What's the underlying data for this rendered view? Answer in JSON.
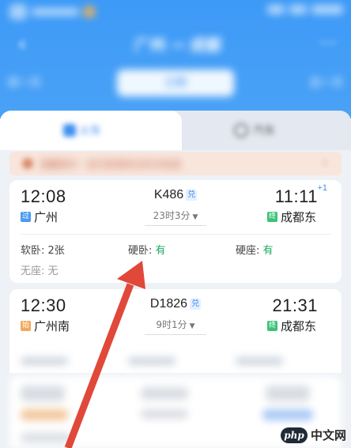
{
  "header": {
    "route_title": "广州 ⇀ 成都",
    "date_prev": "前一天",
    "date_next": "后一天",
    "date_selected": "日期"
  },
  "tabs": {
    "train": "火车",
    "other": "汽车"
  },
  "notice": "温馨提示 · 出行前请关注车次信息",
  "trains": [
    {
      "dep_time": "12:08",
      "arr_time": "11:11",
      "plus_day": "+1",
      "dep_tag": "过",
      "dep_station": "广州",
      "arr_tag": "终",
      "arr_station": "成都东",
      "train_no": "K486",
      "exchange": "兑",
      "duration": "23时3分",
      "seats": [
        {
          "label": "软卧: ",
          "value": "2张",
          "available": false
        },
        {
          "label": "硬卧: ",
          "value": "有",
          "available": true
        },
        {
          "label": "硬座: ",
          "value": "有",
          "available": true
        },
        {
          "label": "无座: ",
          "value": "无",
          "available": false
        }
      ]
    },
    {
      "dep_time": "12:30",
      "arr_time": "21:31",
      "dep_tag": "始",
      "dep_station": "广州南",
      "arr_tag": "终",
      "arr_station": "成都东",
      "train_no": "D1826",
      "exchange": "兑",
      "duration": "9时1分"
    }
  ],
  "watermark": {
    "logo": "php",
    "text": "中文网"
  },
  "colors": {
    "header_blue": "#4aa2f6",
    "accent_blue": "#3d8ef0",
    "available_green": "#1fa862",
    "arrow_red": "#e0483a"
  }
}
